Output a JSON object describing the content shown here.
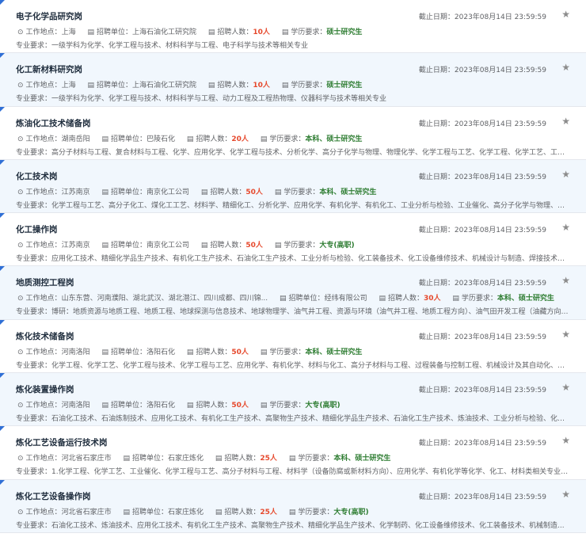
{
  "labels": {
    "deadline": "截止日期：",
    "location": "工作地点：",
    "unit": "招聘单位：",
    "count": "招聘人数：",
    "education": "学历要求：",
    "major": "专业要求："
  },
  "jobs": [
    {
      "title": "电子化学品研究岗",
      "deadline": "2023年08月14日 23:59:59",
      "location": "上海",
      "unit": "上海石油化工研究院",
      "count": "10人",
      "education": "硕士研究生",
      "major": "一级学科为化学、化学工程与技术、材料科学与工程、电子科学与技术等相关专业"
    },
    {
      "title": "化工新材料研究岗",
      "deadline": "2023年08月14日 23:59:59",
      "location": "上海",
      "unit": "上海石油化工研究院",
      "count": "10人",
      "education": "硕士研究生",
      "major": "一级学科为化学、化学工程与技术、材料科学与工程、动力工程及工程热物理、仪器科学与技术等相关专业"
    },
    {
      "title": "炼油化工技术储备岗",
      "deadline": "2023年08月14日 23:59:59",
      "location": "湖南岳阳",
      "unit": "巴陵石化",
      "count": "20人",
      "education": "本科、硕士研究生",
      "major": "高分子材料与工程、复合材料与工程、化学、应用化学、化学工程与技术、分析化学、高分子化学与物理、物理化学、化学工程与工艺、化学工程、化学工艺、工业催..."
    },
    {
      "title": "化工技术岗",
      "deadline": "2023年08月14日 23:59:59",
      "location": "江苏南京",
      "unit": "南京化工公司",
      "count": "50人",
      "education": "本科、硕士研究生",
      "major": "化学工程与工艺、高分子化工、煤化工工艺、材料学、精细化工、分析化学、应用化学、有机化学、有机化工、工业分析与检验、工业催化、高分子化学与物理、高分..."
    },
    {
      "title": "化工操作岗",
      "deadline": "2023年08月14日 23:59:59",
      "location": "江苏南京",
      "unit": "南京化工公司",
      "count": "50人",
      "education": "大专(高职)",
      "major": "应用化工技术、精细化学品生产技术、有机化工生产技术、石油化工生产技术、工业分析与检验、化工装备技术、化工设备维修技术、机械设计与制造、焊接技术及自..."
    },
    {
      "title": "地质测控工程岗",
      "deadline": "2023年08月14日 23:59:59",
      "location": "山东东营、河南濮阳、湖北武汉、湖北潜江、四川成都、四川锦...",
      "unit": "经纬有限公司",
      "count": "30人",
      "education": "本科、硕士研究生",
      "major": "博研：地质资源与地质工程、地质工程、地球探测与信息技术、地球物理学、油气井工程、资源与环境（油气井工程、地质工程方向）、油气田开发工程（油藏方向）..."
    },
    {
      "title": "炼化技术储备岗",
      "deadline": "2023年08月14日 23:59:59",
      "location": "河南洛阳",
      "unit": "洛阳石化",
      "count": "50人",
      "education": "本科、硕士研究生",
      "major": "化学工程、化学工艺、化学工程与技术、化学工程与工艺、应用化学、有机化学、材料与化工、高分子材料与工程、过程装备与控制工程、机械设计及其自动化、机械..."
    },
    {
      "title": "炼化装置操作岗",
      "deadline": "2023年08月14日 23:59:59",
      "location": "河南洛阳",
      "unit": "洛阳石化",
      "count": "50人",
      "education": "大专(高职)",
      "major": "石油化工技术、石油炼制技术、应用化工技术、有机化工生产技术、高聚物生产技术、精细化学品生产技术、石油化工生产技术、炼油技术、工业分析与检验、化工设..."
    },
    {
      "title": "炼化工艺设备运行技术岗",
      "deadline": "2023年08月14日 23:59:59",
      "location": "河北省石家庄市",
      "unit": "石家庄炼化",
      "count": "25人",
      "education": "本科、硕士研究生",
      "major": "1.化学工程、化学工艺、工业催化、化学工程与工艺、高分子材料与工程、材料学（设备防腐或新材料方向）、应用化学、有机化学等化学、化工、材料类相关专业；..."
    },
    {
      "title": "炼化工艺设备操作岗",
      "deadline": "2023年08月14日 23:59:59",
      "location": "河北省石家庄市",
      "unit": "石家庄炼化",
      "count": "25人",
      "education": "大专(高职)",
      "major": "石油化工技术、炼油技术、应用化工技术、有机化工生产技术、高聚物生产技术、精细化学品生产技术、化学制药、化工设备维修技术、化工装备技术、机械制造..."
    }
  ]
}
